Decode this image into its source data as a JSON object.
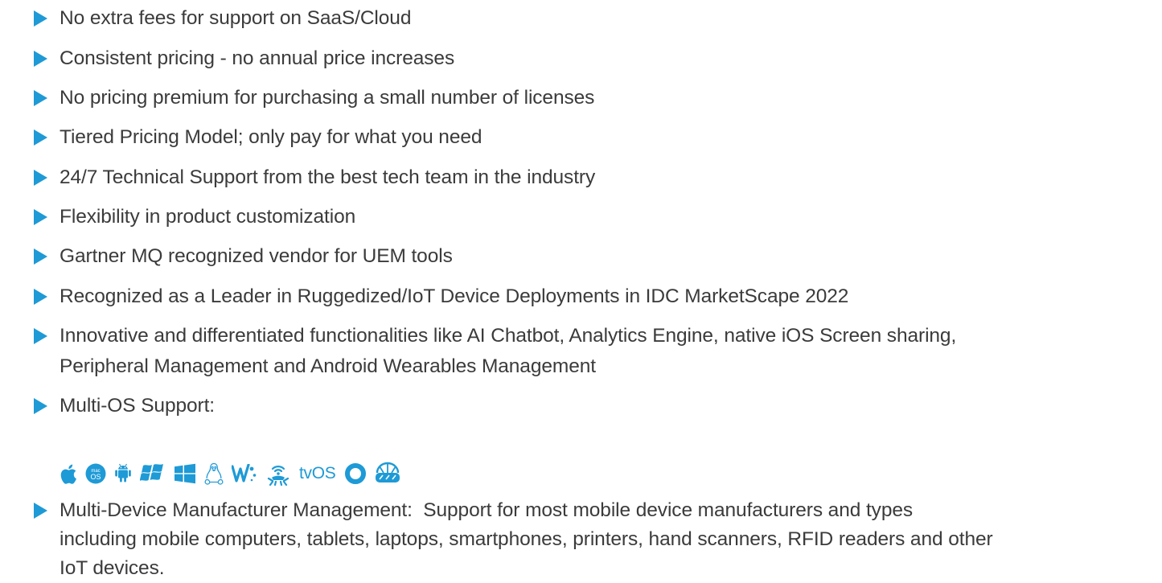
{
  "features": [
    {
      "lines": [
        "No extra fees for support on SaaS/Cloud"
      ]
    },
    {
      "lines": [
        "Consistent pricing - no annual price increases"
      ]
    },
    {
      "lines": [
        "No pricing premium for purchasing a small number of licenses"
      ]
    },
    {
      "lines": [
        "Tiered Pricing Model; only pay for what you need"
      ]
    },
    {
      "lines": [
        "24/7 Technical Support from the best tech team in the industry"
      ]
    },
    {
      "lines": [
        "Flexibility in product customization"
      ]
    },
    {
      "lines": [
        "Gartner MQ recognized vendor for UEM tools"
      ]
    },
    {
      "lines": [
        "Recognized as a Leader in Ruggedized/IoT Device Deployments in IDC MarketScape 2022"
      ]
    },
    {
      "lines": [
        "Innovative and differentiated functionalities like AI Chatbot, Analytics Engine, native iOS Screen sharing,",
        "Peripheral Management and Android Wearables Management"
      ]
    },
    {
      "lines": [
        "Multi-OS Support:"
      ]
    },
    {
      "lines": [
        "Multi-Device Manufacturer Management:  Support for most mobile device manufacturers and types",
        "including mobile computers, tablets, laptops, smartphones, printers, hand scanners, RFID readers and other",
        "IoT devices."
      ]
    }
  ],
  "os_icons": {
    "items": [
      "apple-icon",
      "macos-icon",
      "android-icon",
      "windows-legacy-icon",
      "windows-icon",
      "linux-icon",
      "wearos-icon",
      "iot-icon",
      "tvos-icon",
      "chromeos-icon",
      "visionos-icon"
    ],
    "macos_badge": "mac",
    "macos_os": "OS",
    "tvos_label": "tvOS"
  },
  "colors": {
    "accent": "#1e9ad6",
    "text": "#3b3b3b"
  }
}
